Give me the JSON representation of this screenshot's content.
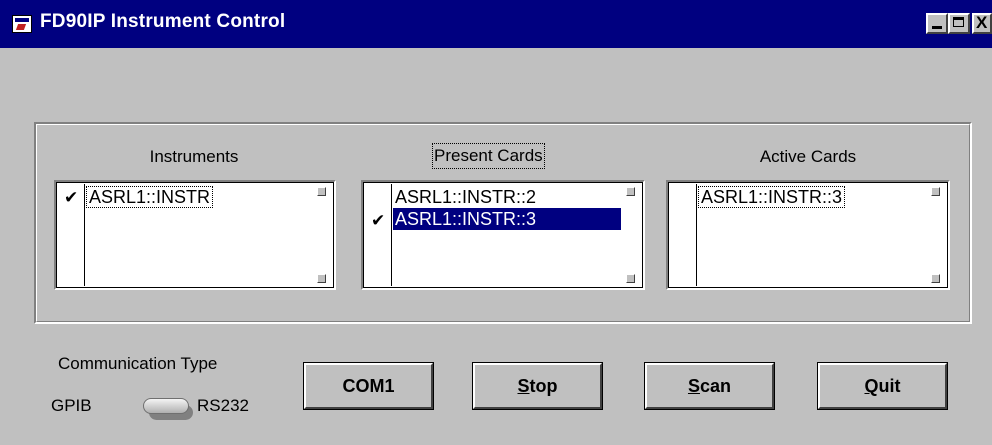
{
  "window": {
    "title": "FD90IP Instrument Control",
    "close_glyph": "X"
  },
  "lists": {
    "instruments": {
      "label": "Instruments",
      "items": [
        {
          "text": "ASRL1::INSTR",
          "checked": true,
          "selected": false,
          "focused": true
        }
      ]
    },
    "present_cards": {
      "label": "Present Cards",
      "items": [
        {
          "text": "ASRL1::INSTR::2",
          "checked": false,
          "selected": false,
          "focused": false
        },
        {
          "text": "ASRL1::INSTR::3",
          "checked": true,
          "selected": true,
          "focused": false
        }
      ]
    },
    "active_cards": {
      "label": "Active Cards",
      "items": [
        {
          "text": "ASRL1::INSTR::3",
          "checked": false,
          "selected": false,
          "focused": true
        }
      ]
    }
  },
  "communication": {
    "label": "Communication Type",
    "left_option": "GPIB",
    "right_option": "RS232",
    "selected": "RS232"
  },
  "buttons": {
    "com": {
      "label": "COM1"
    },
    "stop": {
      "mnemonic": "S",
      "rest": "top"
    },
    "scan": {
      "mnemonic": "S",
      "rest": "can"
    },
    "quit": {
      "mnemonic": "Q",
      "rest": "uit"
    }
  },
  "colors": {
    "titlebar": "#000080",
    "face": "#c0c0c0",
    "selection": "#000080"
  },
  "check_glyph": "✔"
}
